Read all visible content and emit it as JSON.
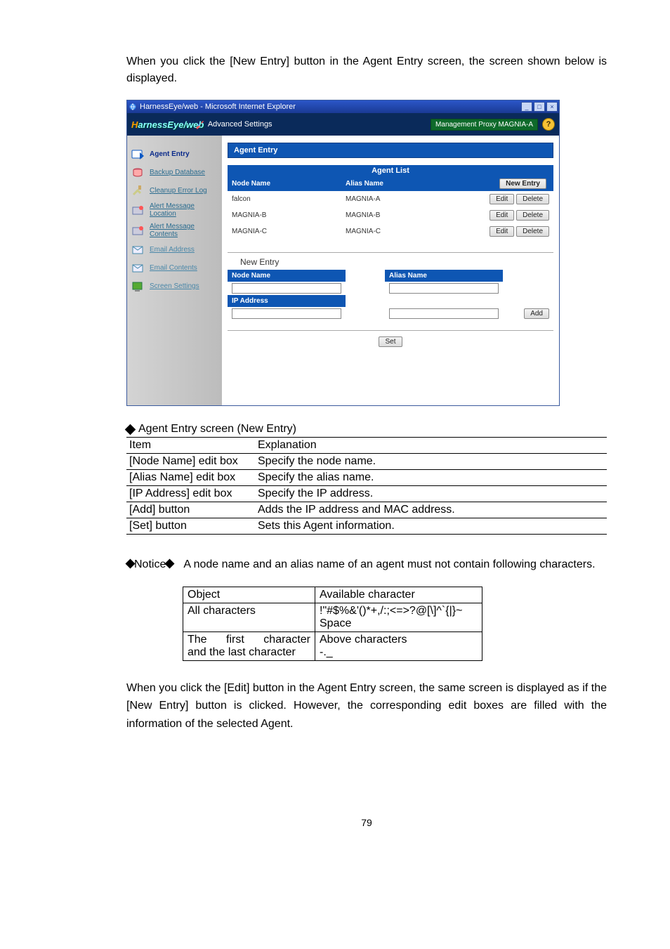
{
  "intro": "When you click the [New Entry] button in the Agent Entry screen, the screen shown below is displayed.",
  "window": {
    "title": "HarnessEye/web - Microsoft Internet Explorer",
    "brand_prefix": "H",
    "brand_rest": "arnessEye/web",
    "advanced_label": "Advanced Settings",
    "proxy_label": "Management Proxy  MAGNIA-A",
    "help_glyph": "?"
  },
  "sidebar": [
    {
      "label": "Agent Entry",
      "active": true
    },
    {
      "label": "Backup Database"
    },
    {
      "label": "Cleanup Error Log"
    },
    {
      "label": "Alert Message Location"
    },
    {
      "label": "Alert Message Contents"
    },
    {
      "label": "Email Address"
    },
    {
      "label": "Email Contents"
    },
    {
      "label": "Screen Settings"
    }
  ],
  "panel": {
    "title": "Agent Entry",
    "list_title": "Agent List",
    "col_node": "Node Name",
    "col_alias": "Alias Name",
    "new_entry_btn": "New Entry",
    "edit_btn": "Edit",
    "delete_btn": "Delete",
    "rows": [
      {
        "node": "falcon",
        "alias": "MAGNIA-A"
      },
      {
        "node": "MAGNIA-B",
        "alias": "MAGNIA-B"
      },
      {
        "node": "MAGNIA-C",
        "alias": "MAGNIA-C"
      }
    ],
    "new_entry_title": "New Entry",
    "form_node": "Node Name",
    "form_alias": "Alias Name",
    "form_ip": "IP Address",
    "add_btn": "Add",
    "set_btn": "Set"
  },
  "section_title": "Agent Entry screen (New Entry)",
  "doc_table": {
    "head_item": "Item",
    "head_expl": "Explanation",
    "rows": [
      {
        "item": "[Node Name] edit box",
        "expl": "Specify the node name."
      },
      {
        "item": "[Alias Name] edit box",
        "expl": "Specify the alias name."
      },
      {
        "item": "[IP Address] edit box",
        "expl": "Specify the IP address."
      },
      {
        "item": "[Add] button",
        "expl": "Adds the IP address and MAC address."
      },
      {
        "item": "[Set] button",
        "expl": "Sets this Agent information."
      }
    ]
  },
  "notice": {
    "lede": "Notice",
    "body": "A node name and an alias name of an agent must not contain following characters."
  },
  "chars_table": {
    "head_obj": "Object",
    "head_avail": "Available character",
    "row1_obj": "All characters",
    "row1_avail_line1": "!\"#$%&'()*+,/:;<=>?@[\\]^`{|}~",
    "row1_avail_line2": "Space",
    "row2_obj_line1": "The first character",
    "row2_obj_line2": "and the last character",
    "row2_avail_line1": "Above characters",
    "row2_avail_line2": "-._"
  },
  "tail": "When you click the [Edit] button in the Agent Entry screen, the same screen is displayed as if the [New Entry] button is clicked. However, the corresponding edit boxes are filled with the information of the selected Agent.",
  "page_number": "79"
}
